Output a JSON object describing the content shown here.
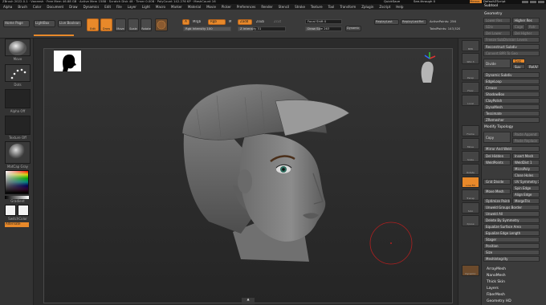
{
  "title_bar": {
    "text": "ZBrush 2022.0.1  ·  Vaneesh  ·  Free Mem 46.88 GB  ·  Active Mem 1588  ·  Scratch Disk 48  ·  Timer 0.008  ·  PolyCount 142.276 KP  ·  MeshCount 16"
  },
  "top_right_tabs": [
    "QuickSave",
    "See-through 0",
    "Menus",
    "DefaultZScript"
  ],
  "menu": [
    "Alpha",
    "Brush",
    "Color",
    "Document",
    "Draw",
    "Dynamics",
    "Edit",
    "File",
    "Layer",
    "Light",
    "Macro",
    "Marker",
    "Material",
    "Movie",
    "Picker",
    "Preferences",
    "Render",
    "Stencil",
    "Stroke",
    "Texture",
    "Tool",
    "Transform",
    "Zplugin",
    "Zscript",
    "Help"
  ],
  "toolbar": {
    "home_page": "Home Page",
    "lightbox": "LightBox",
    "live_boolean": "Live Boolean",
    "edit": "Edit",
    "draw": "Draw",
    "move": "Move",
    "scale": "Scale",
    "rotate": "Rotate",
    "a_label": "A",
    "mrgb": "Mrgb",
    "rgb": "Rgb",
    "m": "M",
    "zadd": "Zadd",
    "zsub": "Zsub",
    "zcut": "Zcut",
    "rgb_intensity": "Rgb Intensity 100",
    "z_intensity": "Z Intensity 31",
    "rgb_intensity_value": 1.0,
    "z_intensity_value": 0.31,
    "focal_shift": "Focal Shift 0",
    "draw_size": "Draw Size 263",
    "dynamic": "Dynamic",
    "replay_last": "ReplayLast",
    "replay_last_rel": "ReplayLastRel",
    "active_points": "ActivePoints: 256",
    "total_points": "TotalPoints: 143,520"
  },
  "left_shelf": {
    "brush": "Move",
    "stroke": "Dots",
    "alpha": "Alpha Off",
    "texture": "Texture Off",
    "material": "MatCap Gray",
    "gradient": "Gradient",
    "switch_color": "SwitchColor",
    "alternate": "Alternate"
  },
  "right_shelf": [
    "BPR",
    "SPix 3",
    "Persp",
    "Floor",
    "Local",
    "Frame",
    "Move",
    "Scale",
    "Rotate",
    "Line Fill",
    "Transp",
    "Solo",
    "Xpose",
    "Dynamic"
  ],
  "right_panel": {
    "subtool": "Subtool",
    "geometry": "Geometry",
    "lower_res": "Lower Res",
    "higher_res": "Higher Res",
    "sdiv": "SDiv",
    "cage": "Cage",
    "rstr": "Rstr",
    "del_lower": "Del Lower",
    "del_higher": "Del Higher",
    "freeze_subdiv": "Freeze SubDivision Levels",
    "reconstruct_subdiv": "Reconstruct Subdiv",
    "convert_bpr": "Convert BPR To Geo",
    "divide": "Divide",
    "smt": "Smt",
    "suv": "Suv",
    "reuv": "ReUV",
    "dynamic_subdiv": "Dynamic Subdiv",
    "edgeloop": "EdgeLoop",
    "crease": "Crease",
    "shadowbox": "ShadowBox",
    "clay_polish": "ClayPolish",
    "dynamesh": "DynaMesh",
    "tessimate": "Tessimate",
    "zremesher": "ZRemesher",
    "modify_topology": "Modify Topology",
    "copy": "Copy",
    "paste_append": "Paste Append",
    "paste_replace": "Paste Replace",
    "mirror_and_weld": "Mirror And Weld",
    "del_hidden": "Del Hidden",
    "insert_mesh": "Insert Mesh",
    "weld_points": "WeldPoints",
    "weld_dist": "WeldDist 1",
    "micropoly": "MicroPoly",
    "close_holes": "Close Holes",
    "grid_divide": "Grid Divide",
    "uv_symmetry": "UV Symmetry X",
    "spin_edge": "Spin Edge",
    "align_edge": "Align Edge",
    "move_mesh": "Move Mesh",
    "optimize_points": "Optimize Points",
    "merge_tris": "MergeTris",
    "unweld_groups_border": "Unweld Groups Border",
    "unweld_all": "Unweld All",
    "delete_by_symmetry": "Delete By Symmetry",
    "equalize_surface_area": "Equalize Surface Area",
    "equalize_edge_length": "Equalize Edge Length",
    "stager": "Stager",
    "position": "Position",
    "size": "Size",
    "mesh_integrity": "MeshIntegrity",
    "array_mesh": "ArrayMesh",
    "nano_mesh": "NanoMesh",
    "thick_skin": "Thick Skin",
    "layers": "Layers",
    "fiber_mesh": "FiberMesh",
    "geometry_hd": "Geometry HD"
  },
  "colors": {
    "accent": "#e8892a",
    "panel": "#3b3b3b",
    "canvas": "#2b2b2b"
  },
  "canvas": {
    "bottom_tab": "▲"
  }
}
